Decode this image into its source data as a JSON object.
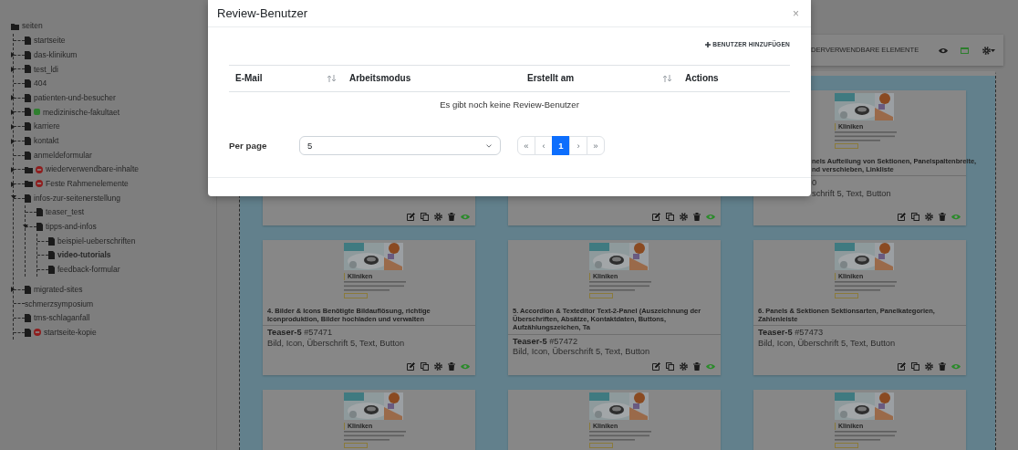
{
  "sidebar": {
    "tree": {
      "label": "seiten",
      "kind": "folder",
      "selected": false,
      "children": [
        {
          "label": "startseite",
          "kind": "page",
          "selected": false
        },
        {
          "label": "das-klinikum",
          "kind": "page",
          "selected": false,
          "expanded": false
        },
        {
          "label": "test_ldi",
          "kind": "page",
          "selected": false,
          "expanded": false
        },
        {
          "label": "404",
          "kind": "page",
          "selected": false
        },
        {
          "label": "patienten-und-besucher",
          "kind": "page",
          "selected": false,
          "expanded": false
        },
        {
          "label": "medizinische-fakultaet",
          "kind": "page",
          "selected": false,
          "expanded": false,
          "online": true
        },
        {
          "label": "karriere",
          "kind": "page",
          "selected": false,
          "expanded": false
        },
        {
          "label": "kontakt",
          "kind": "page",
          "selected": false,
          "expanded": false
        },
        {
          "label": "anmeldeformular",
          "kind": "page",
          "selected": false
        },
        {
          "label": "wiederverwendbare-inhalte",
          "kind": "folder",
          "selected": false,
          "expanded": false,
          "locked": true
        },
        {
          "label": "Feste Rahmenelemente",
          "kind": "folder",
          "selected": false,
          "expanded": false,
          "locked": true
        },
        {
          "label": "infos-zur-seitenerstellung",
          "kind": "page",
          "selected": false,
          "expanded": true,
          "children": [
            {
              "label": "teaser_test",
              "kind": "page",
              "selected": false
            },
            {
              "label": "tipps-and-infos",
              "kind": "page",
              "selected": false,
              "expanded": true,
              "children": [
                {
                  "label": "beispiel-ueberschriften",
                  "kind": "page",
                  "selected": false
                },
                {
                  "label": "video-tutorials",
                  "kind": "page",
                  "selected": true
                },
                {
                  "label": "feedback-formular",
                  "kind": "page",
                  "selected": false
                }
              ]
            }
          ]
        },
        {
          "label": "migrated-sites",
          "kind": "page",
          "selected": false,
          "expanded": false
        },
        {
          "label": "schmerzsymposium",
          "kind": "plain",
          "selected": false
        },
        {
          "label": "tms-schlaganfall",
          "kind": "page",
          "selected": false
        },
        {
          "label": "startseite-kopie",
          "kind": "page",
          "selected": false,
          "locked": true
        }
      ]
    }
  },
  "toolbar": {
    "label": "DERVERWENDBARE ELEMENTE"
  },
  "card_rows": [
    [
      {
        "kind": "covered"
      },
      {
        "kind": "covered"
      },
      {
        "kind": "partly-covered",
        "preview_heading": "Kliniken",
        "title_lines": [
          "nels Aufteilung von Sektionen, Panelspaltenbreite,",
          "nd verschieben, Linkliste"
        ],
        "teaser_id": "0",
        "elements": "schrift 5, Text, Button"
      }
    ],
    [
      {
        "kind": "full",
        "preview_heading": "Kliniken",
        "title": "4. Bilder & Icons Benötigte Bildauflösung, richtige Iconproduktion, Bilder hochladen und verwalten",
        "teaser_name": "Teaser-5",
        "teaser_id": "#57471",
        "elements": "Bild, Icon, Überschrift 5, Text, Button"
      },
      {
        "kind": "full",
        "preview_heading": "Kliniken",
        "title": "5. Accordion & Texteditor Text-2-Panel (Auszeichnung der Überschriften, Absätze, Kontaktdaten, Buttons, Aufzählungszeichen, Ta",
        "teaser_name": "Teaser-5",
        "teaser_id": "#57472",
        "elements": "Bild, Icon, Überschrift 5, Text, Button"
      },
      {
        "kind": "full",
        "preview_heading": "Kliniken",
        "title": "6. Panels & Sektionen Sektionsarten, Panelkategorien, Zahlenleiste",
        "teaser_name": "Teaser-5",
        "teaser_id": "#57473",
        "elements": "Bild, Icon, Überschrift 5, Text, Button"
      }
    ],
    [
      {
        "kind": "top-only",
        "preview_heading": "Kliniken"
      },
      {
        "kind": "top-only",
        "preview_heading": "Kliniken"
      },
      {
        "kind": "top-only",
        "preview_heading": "Kliniken"
      }
    ]
  ],
  "modal": {
    "title": "Review-Benutzer",
    "close": "×",
    "add_button": "BENUTZER HINZUFÜGEN",
    "table": {
      "columns": [
        {
          "label": "E-Mail",
          "sortable": true
        },
        {
          "label": "Arbeitsmodus",
          "sortable": false
        },
        {
          "label": "Erstellt am",
          "sortable": true
        },
        {
          "label": "Actions",
          "sortable": false
        }
      ],
      "empty_message": "Es gibt noch keine Review-Benutzer"
    },
    "per_page": {
      "label": "Per page",
      "value": "5"
    },
    "pagination": [
      {
        "label": "«",
        "selected": false
      },
      {
        "label": "‹",
        "selected": false
      },
      {
        "label": "1",
        "selected": true
      },
      {
        "label": "›",
        "selected": false
      },
      {
        "label": "»",
        "selected": false
      }
    ]
  }
}
